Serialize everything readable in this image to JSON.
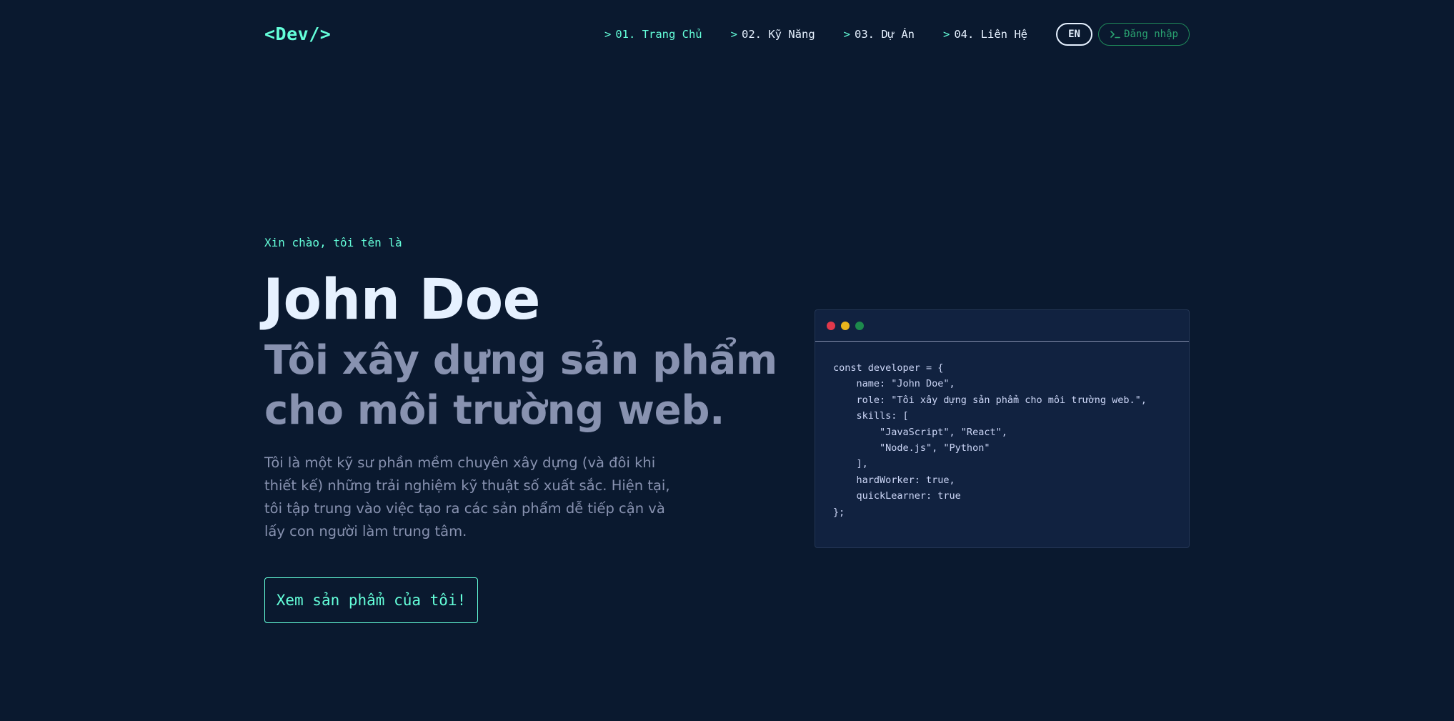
{
  "header": {
    "logo": "<Dev/>",
    "nav": [
      {
        "caret": ">",
        "label": "01. Trang Chủ"
      },
      {
        "caret": ">",
        "label": "02. Kỹ Năng"
      },
      {
        "caret": ">",
        "label": "03. Dự Án"
      },
      {
        "caret": ">",
        "label": "04. Liên Hệ"
      }
    ],
    "language_button": "EN",
    "login_button": "Đăng nhập",
    "login_icon": "terminal-icon"
  },
  "hero": {
    "greeting": "Xin chào, tôi tên là",
    "name": "John Doe",
    "tagline": "Tôi xây dựng sản phẩm cho môi trường web.",
    "intro": "Tôi là một kỹ sư phần mềm chuyên xây dựng (và đôi khi thiết kế) những trải nghiệm kỹ thuật số xuất sắc. Hiện tại, tôi tập trung vào việc tạo ra các sản phẩm dễ tiếp cận và lấy con người làm trung tâm.",
    "cta": "Xem sản phẩm của tôi!"
  },
  "code_window": {
    "window_dots": [
      "#e0384b",
      "#e9b51c",
      "#1d8a4c"
    ],
    "lines": [
      "const developer = {",
      "    name: \"John Doe\",",
      "    role: \"Tôi xây dựng sản phẩm cho môi trường web.\",",
      "    skills: [",
      "        \"JavaScript\", \"React\",",
      "        \"Node.js\", \"Python\"",
      "    ],",
      "    hardWorker: true,",
      "    quickLearner: true",
      "};"
    ]
  },
  "colors": {
    "background": "#0a192f",
    "accent": "#64ffda",
    "heading": "#e6f1ff",
    "muted": "#8892b0",
    "panel": "#112240",
    "login_green": "#2aa371"
  }
}
